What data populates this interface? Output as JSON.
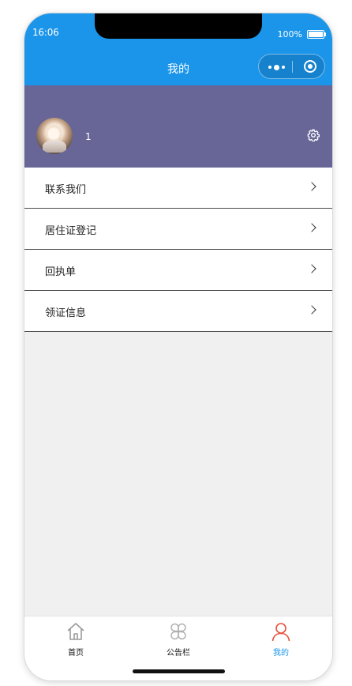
{
  "status": {
    "time": "16:06",
    "battery": "100%"
  },
  "nav": {
    "title": "我的"
  },
  "profile": {
    "username": "1"
  },
  "menu": {
    "items": [
      {
        "label": "联系我们"
      },
      {
        "label": "居住证登记"
      },
      {
        "label": "回执单"
      },
      {
        "label": "领证信息"
      }
    ]
  },
  "tabbar": {
    "tabs": [
      {
        "label": "首页",
        "icon": "home-icon"
      },
      {
        "label": "公告栏",
        "icon": "clover-icon"
      },
      {
        "label": "我的",
        "icon": "person-icon",
        "active": true
      }
    ]
  },
  "colors": {
    "header": "#1a95ea",
    "profile_bg": "#686597",
    "active_tab": "#1a95ea",
    "active_icon": "#e8503a"
  }
}
